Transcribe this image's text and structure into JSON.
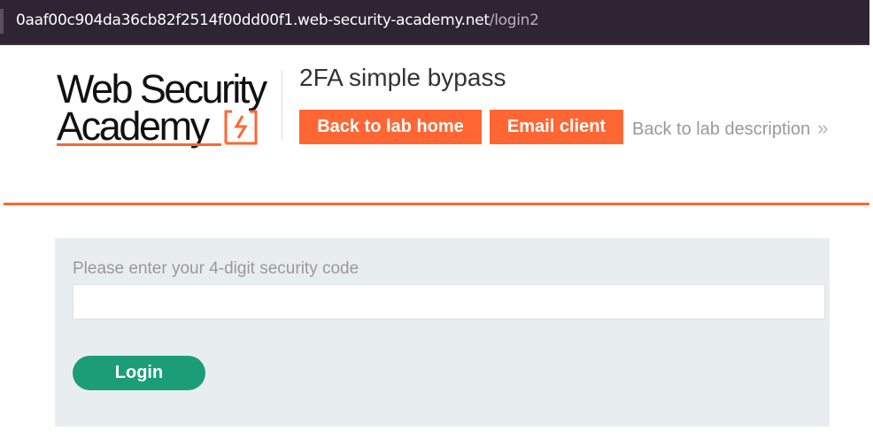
{
  "browser": {
    "url_host": "0aaf00c904da36cb82f2514f00dd00f1.web-security-academy.net",
    "url_path": "/login2"
  },
  "header": {
    "logo_line1": "Web Security",
    "logo_line2": "Academy",
    "lab_title": "2FA simple bypass",
    "back_home_label": "Back to lab home",
    "email_client_label": "Email client",
    "back_description_label": "Back to lab description",
    "chevron": "»"
  },
  "form": {
    "label": "Please enter your 4-digit security code",
    "input_value": "",
    "login_label": "Login"
  },
  "colors": {
    "accent": "#ff6633",
    "login_button": "#1b9e77",
    "panel_bg": "#e8eef0",
    "url_bar_bg": "#2e2433"
  },
  "icons": {
    "logo_mark": "academy-logo-icon",
    "chevron": "double-chevron-right-icon"
  }
}
